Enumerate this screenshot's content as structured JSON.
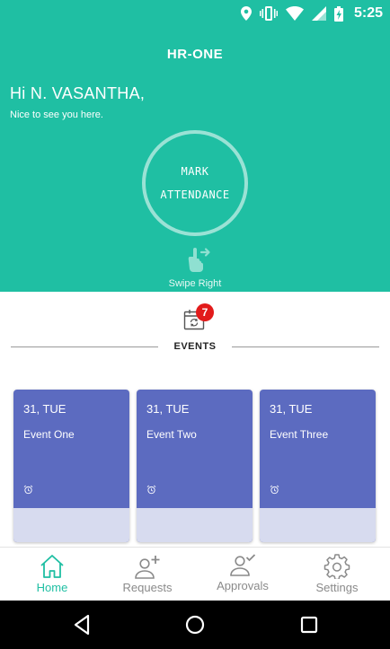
{
  "status_bar": {
    "time": "5:25"
  },
  "header": {
    "app_title": "HR-ONE",
    "greeting": "Hi N. VASANTHA,",
    "subtitle": "Nice to see you here.",
    "mark_attendance": [
      "MARK",
      "ATTENDANCE"
    ],
    "swipe_label": "Swipe Right"
  },
  "events": {
    "title": "EVENTS",
    "badge_count": "7",
    "cards": [
      {
        "date": "31, TUE",
        "name": "Event One"
      },
      {
        "date": "31, TUE",
        "name": "Event Two"
      },
      {
        "date": "31, TUE",
        "name": "Event Three"
      }
    ]
  },
  "bottom_nav": {
    "items": [
      {
        "label": "Home",
        "icon": "home-icon",
        "active": true
      },
      {
        "label": "Requests",
        "icon": "add-person-icon",
        "active": false
      },
      {
        "label": "Approvals",
        "icon": "approve-person-icon",
        "active": false
      },
      {
        "label": "Settings",
        "icon": "gear-icon",
        "active": false
      }
    ]
  },
  "colors": {
    "primary": "#1fbfa3",
    "card": "#5c6bc0",
    "badge": "#e21b1b"
  }
}
